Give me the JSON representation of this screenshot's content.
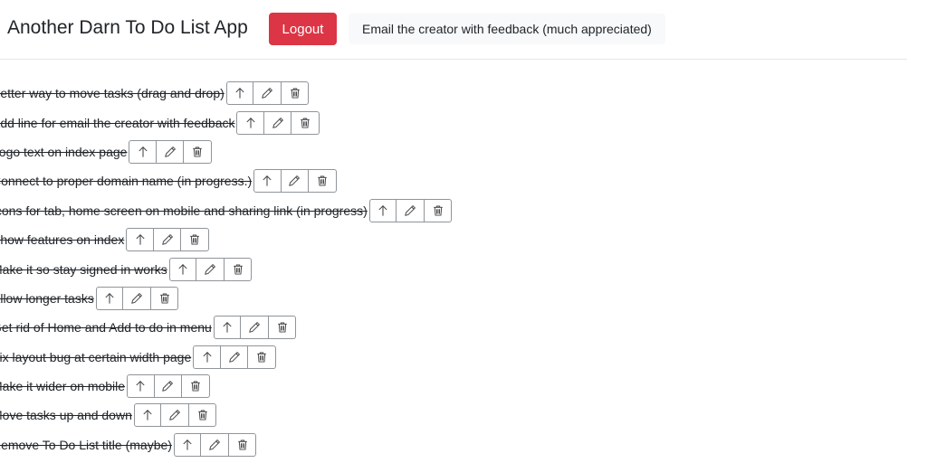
{
  "header": {
    "title": "Another Darn To Do List App",
    "logout_label": "Logout",
    "feedback_label": "Email the creator with feedback (much appreciated)"
  },
  "tasks": [
    {
      "text": "Better way to move tasks (drag and drop)",
      "completed": true
    },
    {
      "text": "Add line for email the creator with feedback",
      "completed": true
    },
    {
      "text": "Logo text on index page",
      "completed": true
    },
    {
      "text": "Connect to proper domain name (in progress.)",
      "completed": true
    },
    {
      "text": "Icons for tab, home screen on mobile and sharing link (in progress)",
      "completed": true
    },
    {
      "text": "Show features on index",
      "completed": true
    },
    {
      "text": "Make it so stay signed in works",
      "completed": true
    },
    {
      "text": "Allow longer tasks",
      "completed": true
    },
    {
      "text": "Get rid of Home and Add to do in menu",
      "completed": true
    },
    {
      "text": "Fix layout bug at certain width page",
      "completed": true
    },
    {
      "text": "Make it wider on mobile",
      "completed": true
    },
    {
      "text": "Move tasks up and down",
      "completed": true
    },
    {
      "text": "Remove To Do List title (maybe)",
      "completed": true
    }
  ],
  "task_actions": {
    "move_up_icon": "arrow-up-icon",
    "edit_icon": "pencil-icon",
    "delete_icon": "trash-icon"
  },
  "colors": {
    "logout": "#dc3545",
    "feedback_bg": "#f8f9fa",
    "button_border": "#8f959a"
  }
}
